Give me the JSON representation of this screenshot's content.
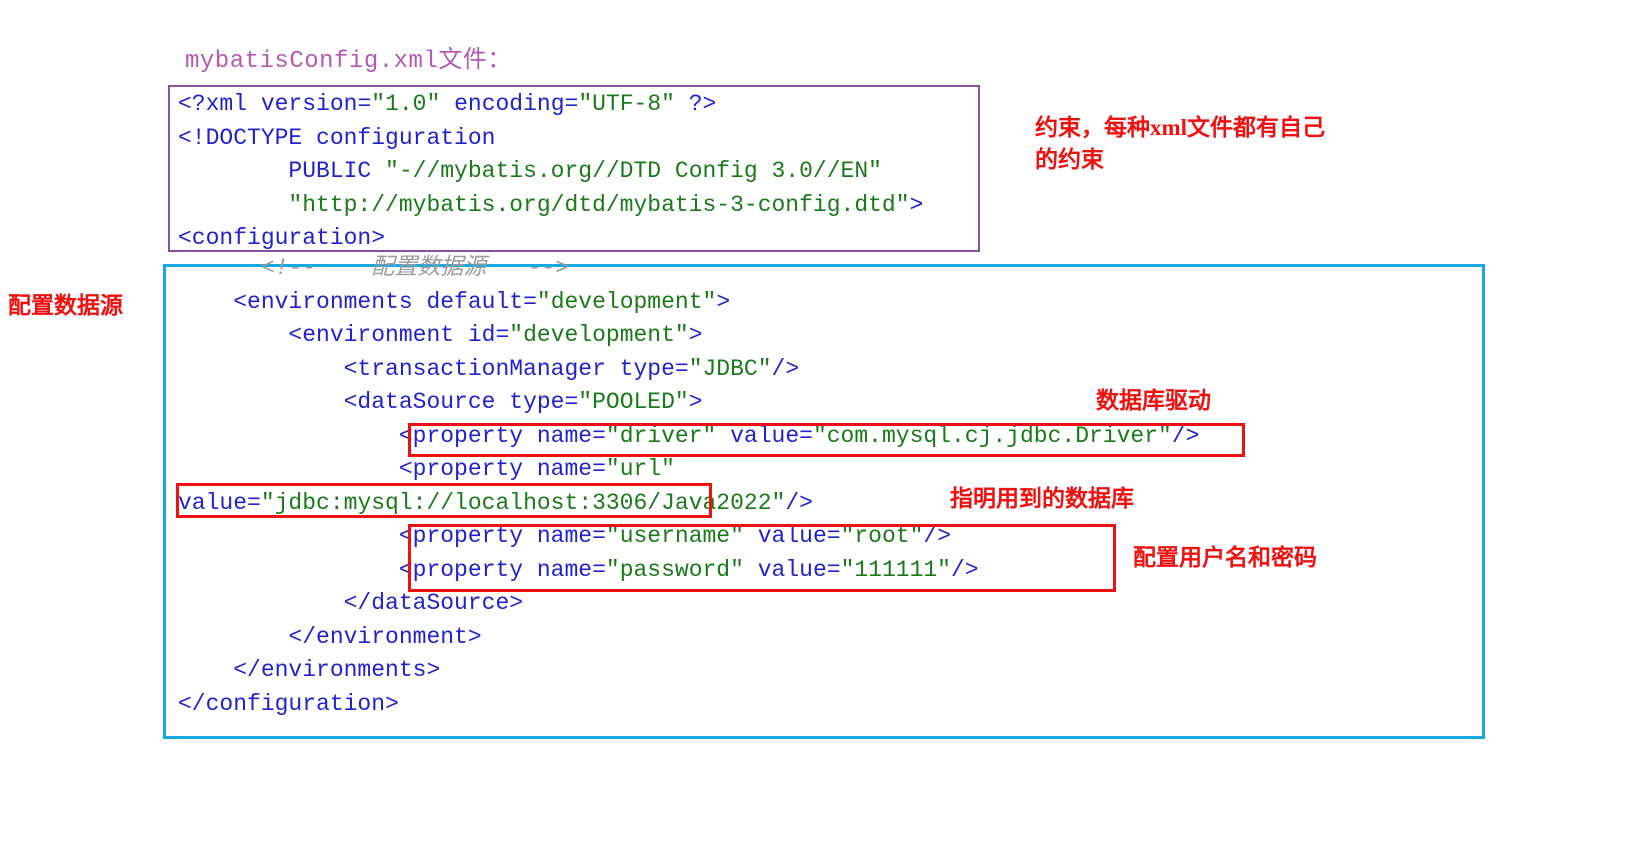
{
  "document": {
    "title": "mybatisConfig.xml文件："
  },
  "prolog_block": {
    "border_color": "#8e4f9e",
    "lines": [
      {
        "segments": [
          {
            "text": "<?xml ",
            "style": "tag"
          },
          {
            "text": "version",
            "style": "attr"
          },
          {
            "text": "=",
            "style": "eq"
          },
          {
            "text": "\"1.0\"",
            "style": "val"
          },
          {
            "text": " ",
            "style": "tag"
          },
          {
            "text": "encoding",
            "style": "attr"
          },
          {
            "text": "=",
            "style": "eq"
          },
          {
            "text": "\"UTF-8\"",
            "style": "val"
          },
          {
            "text": " ?>",
            "style": "tag"
          }
        ]
      },
      {
        "segments": [
          {
            "text": "<!DOCTYPE configuration",
            "style": "tag"
          }
        ]
      },
      {
        "segments": [
          {
            "text": "        PUBLIC ",
            "style": "tag"
          },
          {
            "text": "\"-//mybatis.org//DTD Config 3.0//EN\"",
            "style": "val"
          }
        ]
      },
      {
        "segments": [
          {
            "text": "        ",
            "style": "tag"
          },
          {
            "text": "\"http://mybatis.org/dtd/mybatis-3-config.dtd\"",
            "style": "val"
          },
          {
            "text": ">",
            "style": "tag"
          }
        ]
      },
      {
        "segments": [
          {
            "text": "<configuration>",
            "style": "tag"
          }
        ]
      }
    ]
  },
  "config_block": {
    "border_color": "#1aa8e0",
    "lines": [
      {
        "segments": [
          {
            "text": "      <!--    配置数据源   -->",
            "style": "comment"
          }
        ]
      },
      {
        "segments": [
          {
            "text": "    <environments ",
            "style": "tag"
          },
          {
            "text": "default",
            "style": "attr"
          },
          {
            "text": "=",
            "style": "eq"
          },
          {
            "text": "\"development\"",
            "style": "val"
          },
          {
            "text": ">",
            "style": "tag"
          }
        ]
      },
      {
        "segments": [
          {
            "text": "        <environment ",
            "style": "tag"
          },
          {
            "text": "id",
            "style": "attr"
          },
          {
            "text": "=",
            "style": "eq"
          },
          {
            "text": "\"development\"",
            "style": "val"
          },
          {
            "text": ">",
            "style": "tag"
          }
        ]
      },
      {
        "segments": [
          {
            "text": "            <transactionManager ",
            "style": "tag"
          },
          {
            "text": "type",
            "style": "attr"
          },
          {
            "text": "=",
            "style": "eq"
          },
          {
            "text": "\"JDBC\"",
            "style": "val"
          },
          {
            "text": "/>",
            "style": "tag"
          }
        ]
      },
      {
        "segments": [
          {
            "text": "            <dataSource ",
            "style": "tag"
          },
          {
            "text": "type",
            "style": "attr"
          },
          {
            "text": "=",
            "style": "eq"
          },
          {
            "text": "\"POOLED\"",
            "style": "val"
          },
          {
            "text": ">",
            "style": "tag"
          }
        ]
      },
      {
        "segments": [
          {
            "text": "                <property ",
            "style": "tag"
          },
          {
            "text": "name",
            "style": "attr"
          },
          {
            "text": "=",
            "style": "eq"
          },
          {
            "text": "\"driver\"",
            "style": "val"
          },
          {
            "text": " ",
            "style": "tag"
          },
          {
            "text": "value",
            "style": "attr"
          },
          {
            "text": "=",
            "style": "eq"
          },
          {
            "text": "\"com.mysql.cj.jdbc.Driver\"",
            "style": "val"
          },
          {
            "text": "/>",
            "style": "tag"
          }
        ]
      },
      {
        "segments": [
          {
            "text": "                <property ",
            "style": "tag"
          },
          {
            "text": "name",
            "style": "attr"
          },
          {
            "text": "=",
            "style": "eq"
          },
          {
            "text": "\"url\"",
            "style": "val"
          }
        ]
      },
      {
        "segments": [
          {
            "text": "value",
            "style": "attr"
          },
          {
            "text": "=",
            "style": "eq"
          },
          {
            "text": "\"jdbc:mysql://localhost:3306/Java2022\"",
            "style": "val"
          },
          {
            "text": "/>",
            "style": "tag"
          }
        ]
      },
      {
        "segments": [
          {
            "text": "                <property ",
            "style": "tag"
          },
          {
            "text": "name",
            "style": "attr"
          },
          {
            "text": "=",
            "style": "eq"
          },
          {
            "text": "\"username\"",
            "style": "val"
          },
          {
            "text": " ",
            "style": "tag"
          },
          {
            "text": "value",
            "style": "attr"
          },
          {
            "text": "=",
            "style": "eq"
          },
          {
            "text": "\"root\"",
            "style": "val"
          },
          {
            "text": "/>",
            "style": "tag"
          }
        ]
      },
      {
        "segments": [
          {
            "text": "                <property ",
            "style": "tag"
          },
          {
            "text": "name",
            "style": "attr"
          },
          {
            "text": "=",
            "style": "eq"
          },
          {
            "text": "\"password\"",
            "style": "val"
          },
          {
            "text": " ",
            "style": "tag"
          },
          {
            "text": "value",
            "style": "attr"
          },
          {
            "text": "=",
            "style": "eq"
          },
          {
            "text": "\"111111\"",
            "style": "val"
          },
          {
            "text": "/>",
            "style": "tag"
          }
        ]
      },
      {
        "segments": [
          {
            "text": "            </dataSource>",
            "style": "tag"
          }
        ]
      },
      {
        "segments": [
          {
            "text": "        </environment>",
            "style": "tag"
          }
        ]
      },
      {
        "segments": [
          {
            "text": "    </environments>",
            "style": "tag"
          }
        ]
      },
      {
        "segments": [
          {
            "text": "</configuration>",
            "style": "tag"
          }
        ]
      }
    ]
  },
  "annotations": {
    "color": "#ee1111",
    "dtd_note": "约束，每种xml文件都有自己\n的约束",
    "datasource_label": "配置数据源",
    "driver_note": "数据库驱动",
    "url_note": "指明用到的数据库",
    "userpass_note": "配置用户名和密码"
  },
  "highlight_boxes": {
    "color": "#ee1111",
    "items": [
      {
        "name": "driver-property-highlight"
      },
      {
        "name": "url-value-highlight"
      },
      {
        "name": "username-password-highlight"
      }
    ]
  }
}
